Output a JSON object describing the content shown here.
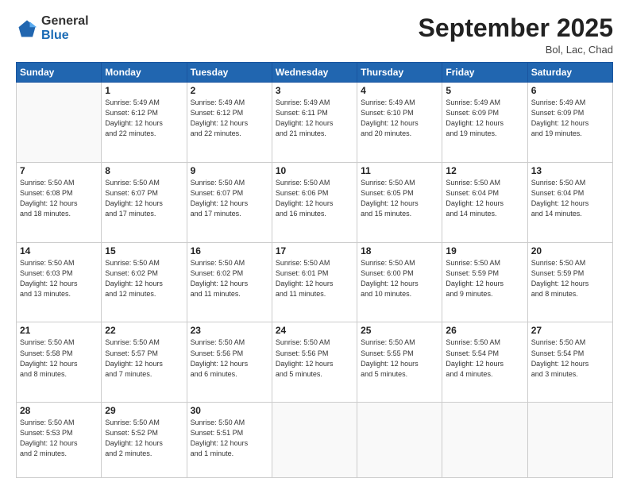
{
  "header": {
    "logo_general": "General",
    "logo_blue": "Blue",
    "month_title": "September 2025",
    "subtitle": "Bol, Lac, Chad"
  },
  "days_of_week": [
    "Sunday",
    "Monday",
    "Tuesday",
    "Wednesday",
    "Thursday",
    "Friday",
    "Saturday"
  ],
  "weeks": [
    [
      {
        "num": "",
        "info": ""
      },
      {
        "num": "1",
        "info": "Sunrise: 5:49 AM\nSunset: 6:12 PM\nDaylight: 12 hours\nand 22 minutes."
      },
      {
        "num": "2",
        "info": "Sunrise: 5:49 AM\nSunset: 6:12 PM\nDaylight: 12 hours\nand 22 minutes."
      },
      {
        "num": "3",
        "info": "Sunrise: 5:49 AM\nSunset: 6:11 PM\nDaylight: 12 hours\nand 21 minutes."
      },
      {
        "num": "4",
        "info": "Sunrise: 5:49 AM\nSunset: 6:10 PM\nDaylight: 12 hours\nand 20 minutes."
      },
      {
        "num": "5",
        "info": "Sunrise: 5:49 AM\nSunset: 6:09 PM\nDaylight: 12 hours\nand 19 minutes."
      },
      {
        "num": "6",
        "info": "Sunrise: 5:49 AM\nSunset: 6:09 PM\nDaylight: 12 hours\nand 19 minutes."
      }
    ],
    [
      {
        "num": "7",
        "info": "Sunrise: 5:50 AM\nSunset: 6:08 PM\nDaylight: 12 hours\nand 18 minutes."
      },
      {
        "num": "8",
        "info": "Sunrise: 5:50 AM\nSunset: 6:07 PM\nDaylight: 12 hours\nand 17 minutes."
      },
      {
        "num": "9",
        "info": "Sunrise: 5:50 AM\nSunset: 6:07 PM\nDaylight: 12 hours\nand 17 minutes."
      },
      {
        "num": "10",
        "info": "Sunrise: 5:50 AM\nSunset: 6:06 PM\nDaylight: 12 hours\nand 16 minutes."
      },
      {
        "num": "11",
        "info": "Sunrise: 5:50 AM\nSunset: 6:05 PM\nDaylight: 12 hours\nand 15 minutes."
      },
      {
        "num": "12",
        "info": "Sunrise: 5:50 AM\nSunset: 6:04 PM\nDaylight: 12 hours\nand 14 minutes."
      },
      {
        "num": "13",
        "info": "Sunrise: 5:50 AM\nSunset: 6:04 PM\nDaylight: 12 hours\nand 14 minutes."
      }
    ],
    [
      {
        "num": "14",
        "info": "Sunrise: 5:50 AM\nSunset: 6:03 PM\nDaylight: 12 hours\nand 13 minutes."
      },
      {
        "num": "15",
        "info": "Sunrise: 5:50 AM\nSunset: 6:02 PM\nDaylight: 12 hours\nand 12 minutes."
      },
      {
        "num": "16",
        "info": "Sunrise: 5:50 AM\nSunset: 6:02 PM\nDaylight: 12 hours\nand 11 minutes."
      },
      {
        "num": "17",
        "info": "Sunrise: 5:50 AM\nSunset: 6:01 PM\nDaylight: 12 hours\nand 11 minutes."
      },
      {
        "num": "18",
        "info": "Sunrise: 5:50 AM\nSunset: 6:00 PM\nDaylight: 12 hours\nand 10 minutes."
      },
      {
        "num": "19",
        "info": "Sunrise: 5:50 AM\nSunset: 5:59 PM\nDaylight: 12 hours\nand 9 minutes."
      },
      {
        "num": "20",
        "info": "Sunrise: 5:50 AM\nSunset: 5:59 PM\nDaylight: 12 hours\nand 8 minutes."
      }
    ],
    [
      {
        "num": "21",
        "info": "Sunrise: 5:50 AM\nSunset: 5:58 PM\nDaylight: 12 hours\nand 8 minutes."
      },
      {
        "num": "22",
        "info": "Sunrise: 5:50 AM\nSunset: 5:57 PM\nDaylight: 12 hours\nand 7 minutes."
      },
      {
        "num": "23",
        "info": "Sunrise: 5:50 AM\nSunset: 5:56 PM\nDaylight: 12 hours\nand 6 minutes."
      },
      {
        "num": "24",
        "info": "Sunrise: 5:50 AM\nSunset: 5:56 PM\nDaylight: 12 hours\nand 5 minutes."
      },
      {
        "num": "25",
        "info": "Sunrise: 5:50 AM\nSunset: 5:55 PM\nDaylight: 12 hours\nand 5 minutes."
      },
      {
        "num": "26",
        "info": "Sunrise: 5:50 AM\nSunset: 5:54 PM\nDaylight: 12 hours\nand 4 minutes."
      },
      {
        "num": "27",
        "info": "Sunrise: 5:50 AM\nSunset: 5:54 PM\nDaylight: 12 hours\nand 3 minutes."
      }
    ],
    [
      {
        "num": "28",
        "info": "Sunrise: 5:50 AM\nSunset: 5:53 PM\nDaylight: 12 hours\nand 2 minutes."
      },
      {
        "num": "29",
        "info": "Sunrise: 5:50 AM\nSunset: 5:52 PM\nDaylight: 12 hours\nand 2 minutes."
      },
      {
        "num": "30",
        "info": "Sunrise: 5:50 AM\nSunset: 5:51 PM\nDaylight: 12 hours\nand 1 minute."
      },
      {
        "num": "",
        "info": ""
      },
      {
        "num": "",
        "info": ""
      },
      {
        "num": "",
        "info": ""
      },
      {
        "num": "",
        "info": ""
      }
    ]
  ]
}
